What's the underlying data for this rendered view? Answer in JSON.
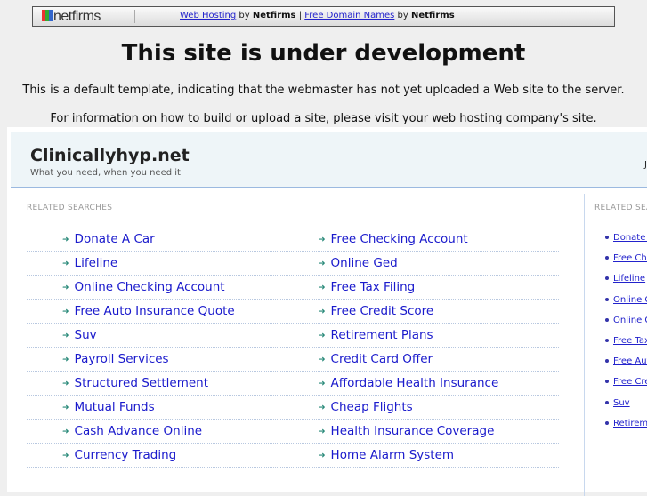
{
  "topbar": {
    "logo": "netfirms",
    "link1": "Web Hosting",
    "by1": "by",
    "brand1": "Netfirms",
    "pipe": "|",
    "link2": "Free Domain Names",
    "by2": "by",
    "brand2": "Netfirms"
  },
  "heading": "This site is under development",
  "para1": "This is a default template, indicating that the webmaster has not yet uploaded a Web site to the server.",
  "para2": "For information on how to build or upload a site, please visit your web hosting company's site.",
  "site": {
    "title": "Clinicallyhyp.net",
    "tagline": "What you need, when you need it",
    "right_text": "Ju"
  },
  "related_label": "RELATED SEARCHES",
  "related_label_right": "RELATED SEARCHES",
  "rows": [
    [
      "Donate A Car",
      "Free Checking Account"
    ],
    [
      "Lifeline",
      "Online Ged"
    ],
    [
      "Online Checking Account",
      "Free Tax Filing"
    ],
    [
      "Free Auto Insurance Quote",
      "Free Credit Score"
    ],
    [
      "Suv",
      "Retirement Plans"
    ],
    [
      "Payroll Services",
      "Credit Card Offer"
    ],
    [
      "Structured Settlement",
      "Affordable Health Insurance"
    ],
    [
      "Mutual Funds",
      "Cheap Flights"
    ],
    [
      "Cash Advance Online",
      "Health Insurance Coverage"
    ],
    [
      "Currency Trading",
      "Home Alarm System"
    ]
  ],
  "right_list": [
    "Donate A Car",
    "Free Checking Account",
    "Lifeline",
    "Online Checking Account",
    "Online Ged",
    "Free Tax Filing",
    "Free Auto Insurance Quote",
    "Free Credit Score",
    "Suv",
    "Retirement Plans"
  ]
}
